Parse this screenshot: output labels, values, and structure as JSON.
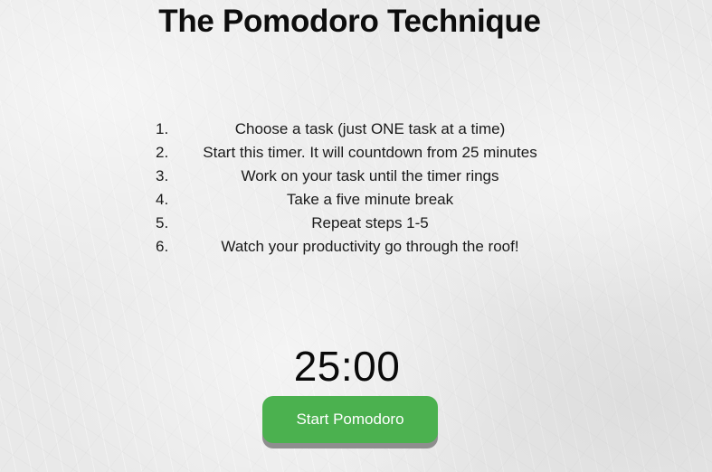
{
  "page": {
    "title": "The Pomodoro Technique"
  },
  "steps": [
    {
      "number": "1.",
      "text": "Choose a task (just ONE task at a time)"
    },
    {
      "number": "2.",
      "text": "Start this timer. It will countdown from 25 minutes"
    },
    {
      "number": "3.",
      "text": "Work on your task until the timer rings"
    },
    {
      "number": "4.",
      "text": "Take a five minute break"
    },
    {
      "number": "5.",
      "text": "Repeat steps 1-5"
    },
    {
      "number": "6.",
      "text": "Watch your productivity go through the roof!"
    }
  ],
  "timer": {
    "display": "25:00"
  },
  "controls": {
    "start_label": "Start Pomodoro"
  },
  "colors": {
    "button": "#4bb14f",
    "button_shadow": "#8e8e8e",
    "text": "#111111"
  }
}
